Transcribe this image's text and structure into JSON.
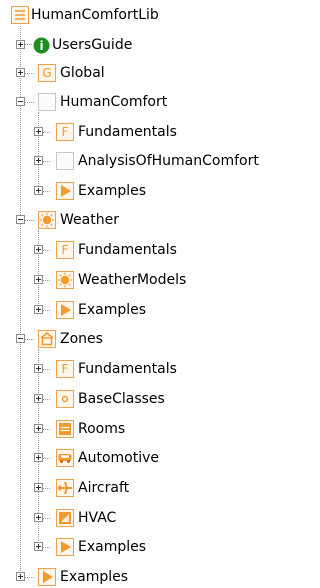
{
  "tree": {
    "root": "HumanComfortLib",
    "users_guide": "UsersGuide",
    "global": "Global",
    "human_comfort": {
      "label": "HumanComfort",
      "children": [
        "Fundamentals",
        "AnalysisOfHumanComfort",
        "Examples"
      ]
    },
    "weather": {
      "label": "Weather",
      "children": [
        "Fundamentals",
        "WeatherModels",
        "Examples"
      ]
    },
    "zones": {
      "label": "Zones",
      "children": [
        "Fundamentals",
        "BaseClasses",
        "Rooms",
        "Automotive",
        "Aircraft",
        "HVAC",
        "Examples"
      ]
    },
    "examples": "Examples"
  },
  "colors": {
    "orange": "#f29a2e",
    "green": "#1e8f1e",
    "line": "#9a9a9a"
  }
}
